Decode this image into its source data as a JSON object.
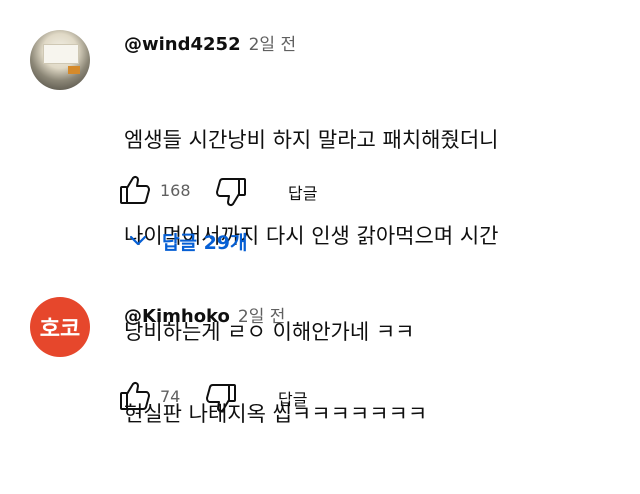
{
  "comments": [
    {
      "author": "@wind4252",
      "time": "2일 전",
      "avatar_text": "",
      "lines": [
        "엠생들 시간낭비 하지 말라고 패치해줬더니",
        "나이먹어서까지 다시 인생 갉아먹으며 시간",
        "낭비하는게 ㄹㅇ 이해안가네 ㅋㅋ"
      ],
      "likes": "168",
      "reply_label": "답글",
      "replies_toggle": "답글 29개"
    },
    {
      "author": "@Kimhoko",
      "time": "2일 전",
      "avatar_text": "호코",
      "lines": [
        "현실판 나태지옥 씹ㅋㅋㅋㅋㅋㅋㅋ"
      ],
      "likes": "74",
      "reply_label": "답글"
    }
  ],
  "icons": {
    "like": "thumbs-up-icon",
    "dislike": "thumbs-down-icon",
    "expand": "chevron-down-icon"
  },
  "colors": {
    "link": "#065fd4",
    "avatar_bg": "#e6472c",
    "meta": "#606060"
  }
}
